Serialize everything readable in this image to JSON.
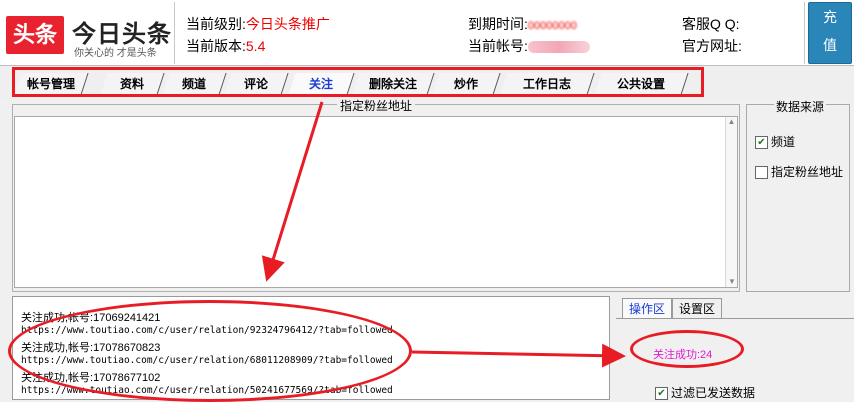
{
  "header": {
    "logo_mark": "头条",
    "logo_name": "今日头条",
    "logo_slogan": "你关心的 才是头条",
    "level_label": "当前级别:",
    "level_value": "今日头条推广",
    "version_label": "当前版本:",
    "version_value": "5.4",
    "expire_label": "到期时间:",
    "expire_value": "00000000",
    "account_label": "当前帐号:",
    "support_qq_label": "客服Q Q:",
    "website_label": "官方网址:",
    "recharge_line1": "充",
    "recharge_line2": "值"
  },
  "tabs": [
    {
      "label": "帐号管理"
    },
    {
      "label": "资料"
    },
    {
      "label": "频道"
    },
    {
      "label": "评论"
    },
    {
      "label": "关注",
      "active": true
    },
    {
      "label": "删除关注"
    },
    {
      "label": "炒作"
    },
    {
      "label": "工作日志"
    },
    {
      "label": "公共设置"
    }
  ],
  "fans_group_title": "指定粉丝地址",
  "data_source": {
    "title": "数据来源",
    "options": [
      {
        "label": "频道",
        "checked": true
      },
      {
        "label": "指定粉丝地址",
        "checked": false
      }
    ]
  },
  "log": [
    "关注成功,帐号:17069241421",
    "https://www.toutiao.com/c/user/relation/92324796412/?tab=followed",
    "关注成功,帐号:17078670823",
    "https://www.toutiao.com/c/user/relation/68011208909/?tab=followed",
    "关注成功,帐号:17078677102",
    "https://www.toutiao.com/c/user/relation/50241677569/?tab=followed"
  ],
  "right_tabs": [
    {
      "label": "操作区",
      "active": true
    },
    {
      "label": "设置区",
      "active": false
    }
  ],
  "operation": {
    "success_text": "关注成功:24",
    "filter_label": "过滤已发送数据",
    "filter_checked": true
  },
  "colors": {
    "accent_red": "#e81c24",
    "active_tab": "#1a3bd6",
    "success_magenta": "#e21ad3",
    "recharge_blue": "#2a86b8"
  }
}
